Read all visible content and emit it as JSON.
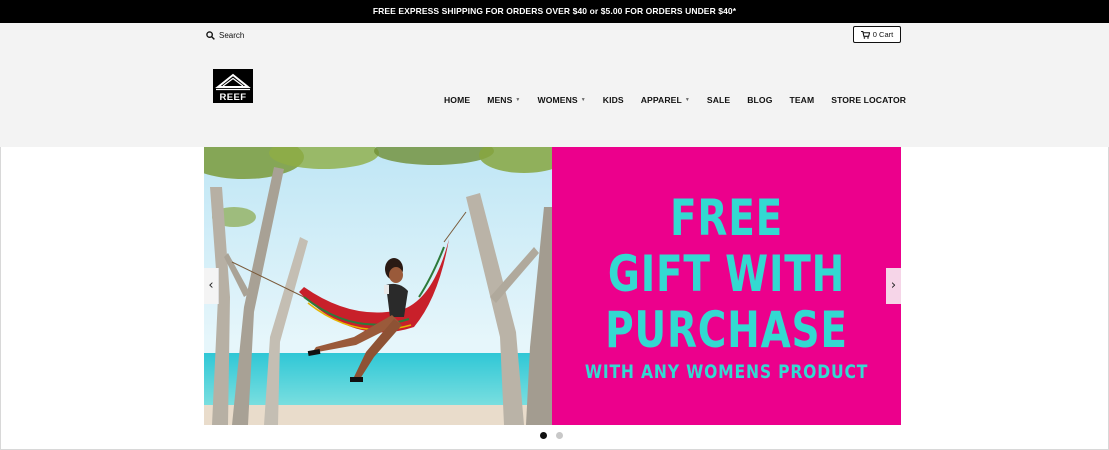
{
  "announcement": "FREE EXPRESS SHIPPING FOR ORDERS OVER $40 or $5.00 FOR ORDERS UNDER $40*",
  "header": {
    "search_label": "Search",
    "cart_label": "0 Cart",
    "logo_text": "REEF"
  },
  "nav": [
    {
      "label": "HOME",
      "has_dropdown": false
    },
    {
      "label": "MENS",
      "has_dropdown": true
    },
    {
      "label": "WOMENS",
      "has_dropdown": true
    },
    {
      "label": "KIDS",
      "has_dropdown": false
    },
    {
      "label": "APPAREL",
      "has_dropdown": true
    },
    {
      "label": "SALE",
      "has_dropdown": false
    },
    {
      "label": "BLOG",
      "has_dropdown": false
    },
    {
      "label": "TEAM",
      "has_dropdown": false
    },
    {
      "label": "STORE LOCATOR",
      "has_dropdown": false
    }
  ],
  "slider": {
    "promo_line1": "FREE",
    "promo_line2": "GIFT WITH",
    "promo_line3": "PURCHASE",
    "promo_line4": "WITH ANY WOMENS PRODUCT",
    "prev_icon": "chevron-left-icon",
    "next_icon": "chevron-right-icon",
    "slide_count": 2,
    "active_slide": 1
  },
  "colors": {
    "announcement_bg": "#000000",
    "header_bg": "#f3f3f3",
    "promo_bg": "#ec008c",
    "promo_text": "#33d9d1"
  }
}
